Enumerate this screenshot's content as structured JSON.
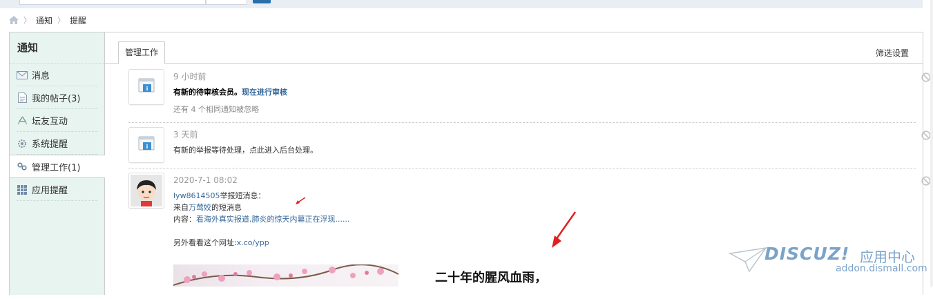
{
  "breadcrumb": {
    "items": [
      "通知",
      "提醒"
    ]
  },
  "sidebar": {
    "title": "通知",
    "items": [
      {
        "label": "消息",
        "icon": "envelope-icon"
      },
      {
        "label": "我的帖子(3)",
        "icon": "document-icon"
      },
      {
        "label": "坛友互动",
        "icon": "recycle-icon"
      },
      {
        "label": "系统提醒",
        "icon": "gear-icon"
      },
      {
        "label": "管理工作(1)",
        "icon": "link-icon",
        "active": true
      },
      {
        "label": "应用提醒",
        "icon": "grid-icon"
      }
    ]
  },
  "main": {
    "tab_label": "管理工作",
    "filter_label": "筛选设置",
    "notices": [
      {
        "time": "9 小时前",
        "text_bold": "有新的待审核会员。",
        "text_link": "现在进行审核",
        "extra": "还有 4 个相同通知被忽略"
      },
      {
        "time": "3 天前",
        "text": "有新的举报等待处理，点此进入后台处理。"
      },
      {
        "time": "2020-7-1 08:02",
        "user_link": "lyw8614505",
        "line1_suffix": "举报短消息：",
        "line2_prefix": "来自",
        "line2_link": "万莺姣",
        "line2_suffix": "的短消息",
        "line3_prefix": "内容：",
        "line3_link": "看海外真实报道,肺炎的惊天内幕正在浮现......",
        "line4_prefix": "另外看看这个网址:",
        "line4_link": "x.co/ypp",
        "poem": "二十年的腥风血雨，"
      }
    ]
  },
  "watermark": {
    "brand": "DISCUZ!",
    "cn": "应用中心",
    "domain": "addon.dismall.com"
  },
  "colors": {
    "accent": "#336699",
    "sidebar_bg": "#e7f4f0",
    "arrow": "#e02020"
  }
}
